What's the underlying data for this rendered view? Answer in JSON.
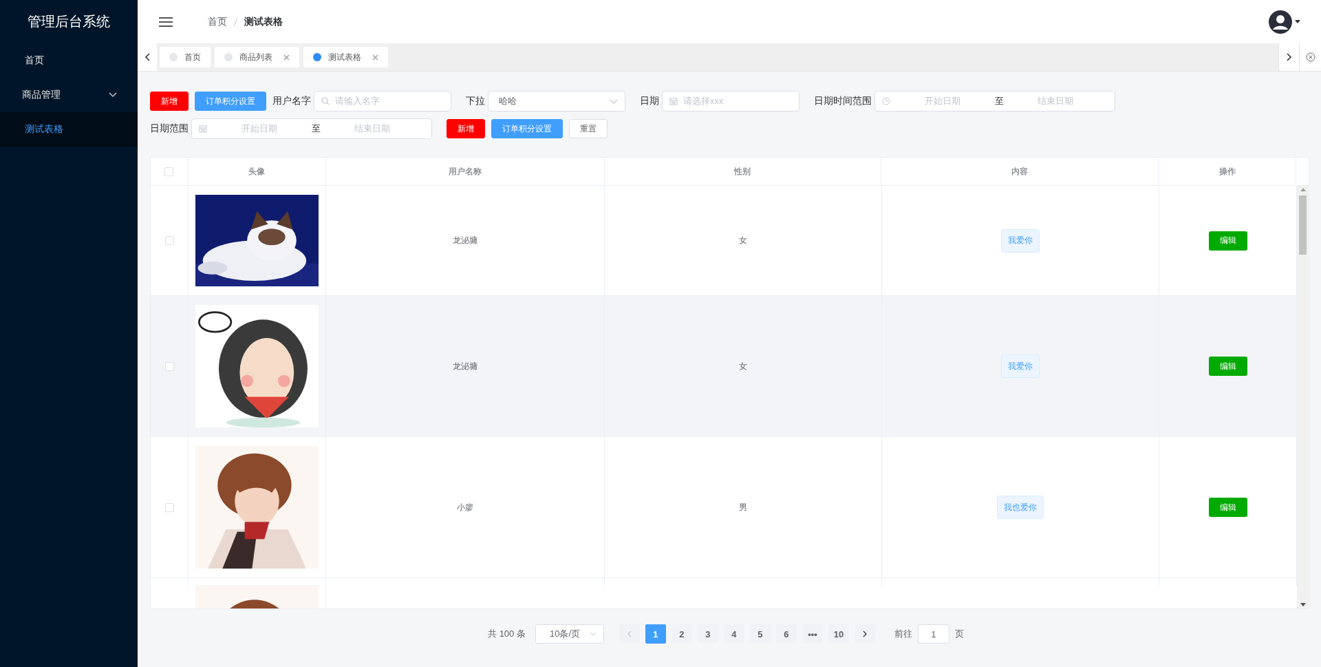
{
  "sidebar": {
    "title": "管理后台系统",
    "items": [
      {
        "label": "首页",
        "kind": "item",
        "selected": false
      },
      {
        "label": "商品管理",
        "kind": "submenu",
        "selected": false
      },
      {
        "label": "测试表格",
        "kind": "item",
        "selected": true
      }
    ]
  },
  "header": {
    "breadcrumb": [
      "首页",
      "测试表格"
    ]
  },
  "tabs": [
    {
      "label": "首页",
      "selected": false,
      "closable": false
    },
    {
      "label": "商品列表",
      "selected": false,
      "closable": true
    },
    {
      "label": "测试表格",
      "selected": true,
      "closable": true
    }
  ],
  "toolbar": [
    [
      {
        "kind": "danger-button",
        "label": "新增"
      },
      {
        "kind": "primary-button",
        "label": "订单积分设置"
      },
      {
        "kind": "text-input",
        "label": "用户名字",
        "placeholder": "请输入名字"
      },
      {
        "kind": "select",
        "label": "下拉",
        "value": "哈哈"
      },
      {
        "kind": "date",
        "label": "日期",
        "placeholder": "请选择xxx"
      },
      {
        "kind": "datetimerange",
        "label": "日期时间范围",
        "start": "开始日期",
        "separator": "至",
        "end": "结束日期"
      }
    ],
    [
      {
        "kind": "daterange",
        "label": "日期范围",
        "start": "开始日期",
        "separator": "至",
        "end": "结束日期"
      },
      {
        "kind": "danger-button",
        "label": "新增"
      },
      {
        "kind": "primary-button",
        "label": "订单积分设置"
      },
      {
        "kind": "plain-button",
        "label": "重置"
      }
    ]
  ],
  "table": {
    "header_checked": false,
    "columns": [
      "头像",
      "用户名称",
      "性别",
      "内容",
      "操作"
    ],
    "rows": [
      {
        "checked": false,
        "highlighted": false,
        "avatar": {
          "kind": "picture"
        },
        "name": "龙泌墉",
        "gender": "女",
        "content": "我爱你",
        "action": "编辑"
      },
      {
        "checked": false,
        "highlighted": true,
        "avatar": {
          "kind": "picture"
        },
        "name": "龙泌墉",
        "gender": "女",
        "content": "我爱你",
        "action": "编辑"
      },
      {
        "checked": false,
        "highlighted": false,
        "avatar": {
          "kind": "picture"
        },
        "name": "小廖",
        "gender": "男",
        "content": "我也爱你",
        "action": "编辑"
      },
      {
        "avatar": {
          "kind": "picture"
        }
      }
    ]
  },
  "pagination": {
    "total": "共 100 条",
    "page_size": "10条/页",
    "pages": [
      {
        "label": "1",
        "selected": true
      },
      {
        "label": "2",
        "selected": false
      },
      {
        "label": "3",
        "selected": false
      },
      {
        "label": "4",
        "selected": false
      },
      {
        "label": "5",
        "selected": false
      },
      {
        "label": "6",
        "selected": false
      },
      {
        "label": "•••",
        "selected": false
      },
      {
        "label": "10",
        "selected": false
      }
    ],
    "jump_label": "前往",
    "jump_value": "1",
    "jump_unit": "页"
  }
}
